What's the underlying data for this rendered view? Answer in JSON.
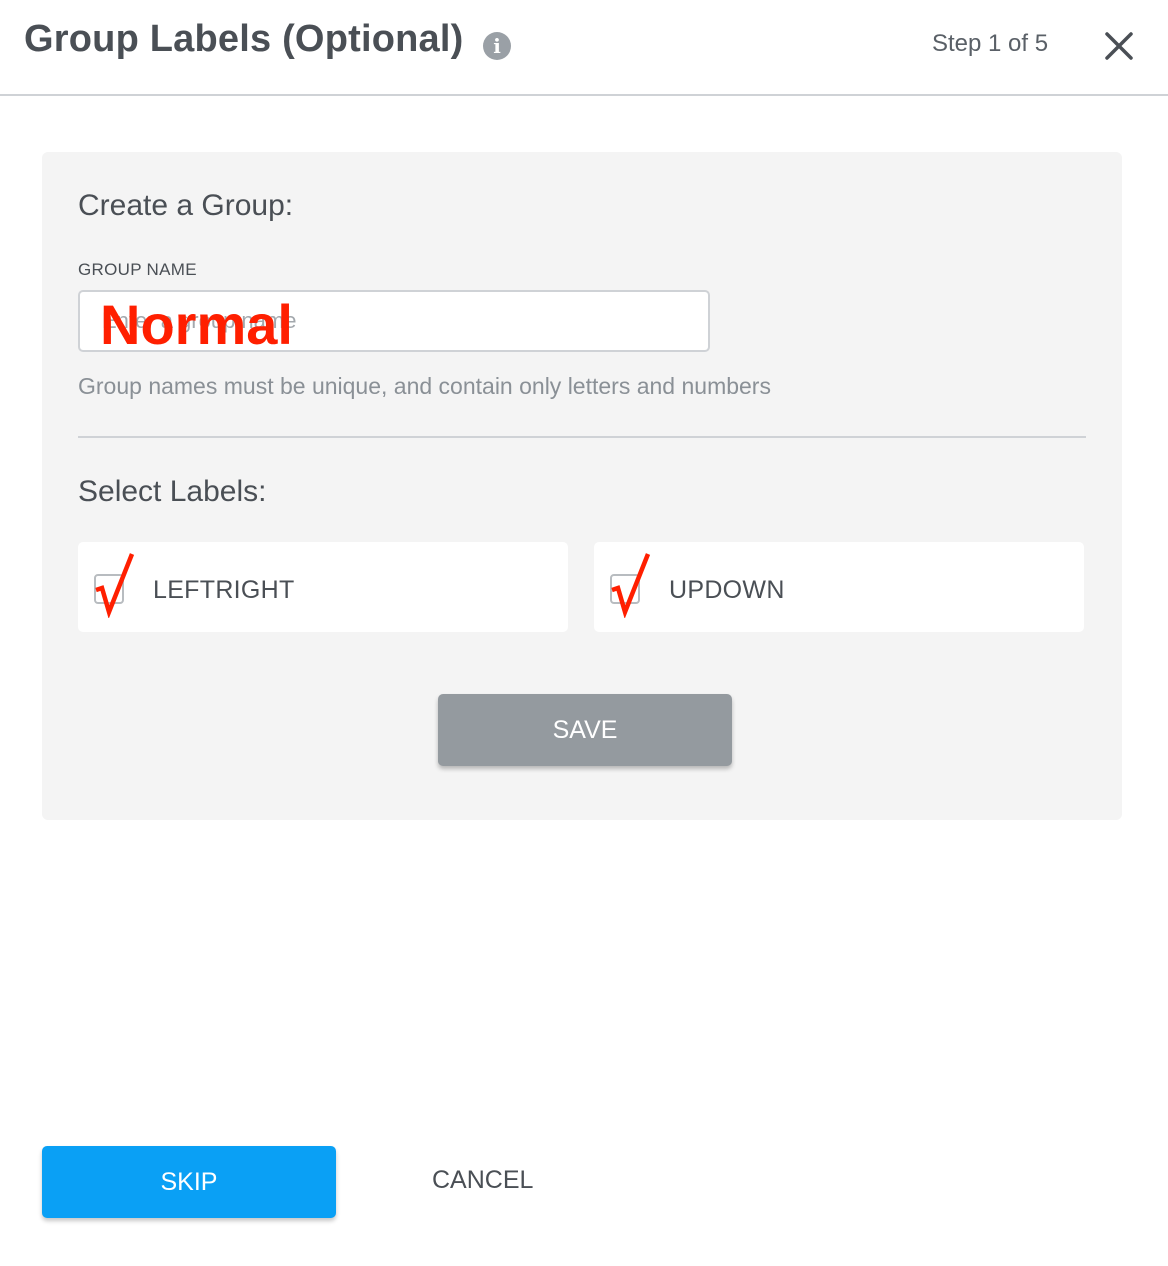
{
  "header": {
    "title": "Group Labels (Optional)",
    "info_icon": "info-icon",
    "step": "Step 1 of 5",
    "close_icon": "close-icon"
  },
  "create_group": {
    "title": "Create a Group:",
    "field_label": "GROUP NAME",
    "input": {
      "value": "",
      "placeholder": "Enter a group name"
    },
    "overlay_annotation": "Normal",
    "hint": "Group names must be unique, and contain only letters and numbers"
  },
  "select_labels": {
    "title": "Select Labels:",
    "items": [
      {
        "label": "LEFTRIGHT",
        "checked": true
      },
      {
        "label": "UPDOWN",
        "checked": true
      }
    ]
  },
  "actions": {
    "save_label": "SAVE",
    "skip_label": "SKIP",
    "cancel_label": "CANCEL"
  },
  "colors": {
    "primary": "#0aa0f5",
    "save_disabled": "#949a9f",
    "annotation_red": "#ff1f00",
    "panel_bg": "#f4f4f4"
  }
}
